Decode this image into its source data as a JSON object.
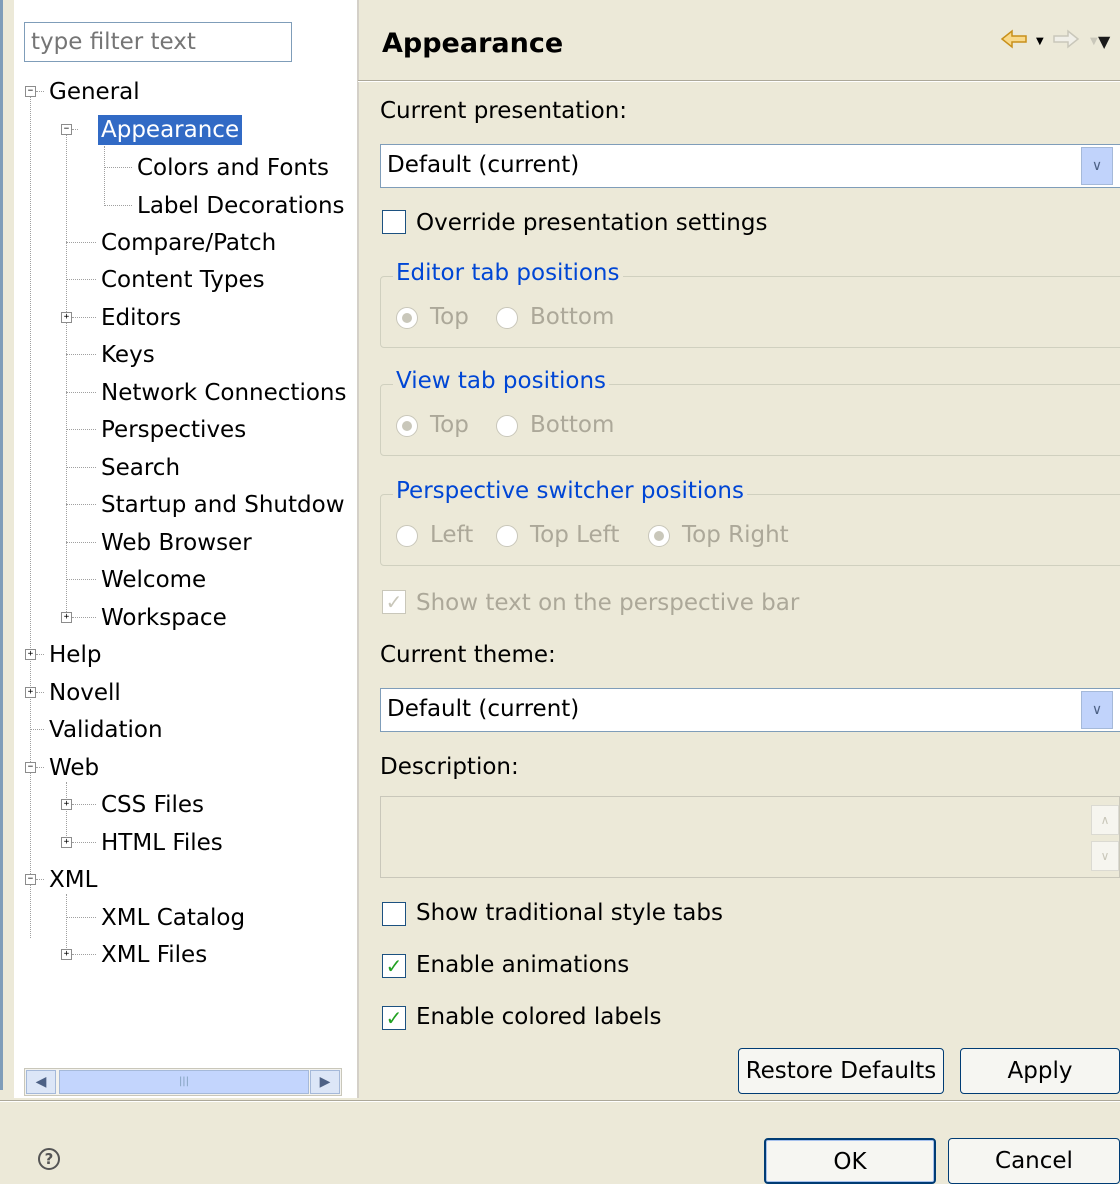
{
  "filter": {
    "placeholder": "type filter text"
  },
  "tree": {
    "general": "General",
    "appearance": "Appearance",
    "colors_fonts": "Colors and Fonts",
    "label_decorations": "Label Decorations",
    "compare_patch": "Compare/Patch",
    "content_types": "Content Types",
    "editors": "Editors",
    "keys": "Keys",
    "network_connections": "Network Connections",
    "perspectives": "Perspectives",
    "search": "Search",
    "startup_shutdown": "Startup and Shutdow",
    "web_browser": "Web Browser",
    "welcome": "Welcome",
    "workspace": "Workspace",
    "help": "Help",
    "novell": "Novell",
    "validation": "Validation",
    "web": "Web",
    "css_files": "CSS Files",
    "html_files": "HTML Files",
    "xml": "XML",
    "xml_catalog": "XML Catalog",
    "xml_files": "XML Files"
  },
  "page": {
    "title": "Appearance",
    "current_presentation_label": "Current presentation:",
    "current_presentation_value": "Default (current)",
    "override_label": "Override presentation settings",
    "editor_tab_group": "Editor tab positions",
    "view_tab_group": "View tab positions",
    "top": "Top",
    "bottom": "Bottom",
    "perspective_group": "Perspective switcher positions",
    "left": "Left",
    "top_left": "Top Left",
    "top_right": "Top Right",
    "show_text_label": "Show text on the perspective bar",
    "current_theme_label": "Current theme:",
    "current_theme_value": "Default (current)",
    "description_label": "Description:",
    "traditional_tabs_label": "Show traditional style tabs",
    "animations_label": "Enable animations",
    "colored_labels_label": "Enable colored labels"
  },
  "buttons": {
    "restore_defaults": "Restore Defaults",
    "apply": "Apply",
    "ok": "OK",
    "cancel": "Cancel"
  },
  "icons": {
    "back": "back-arrow-icon",
    "forward": "forward-arrow-icon",
    "menu": "view-menu-icon",
    "help": "help-icon"
  }
}
